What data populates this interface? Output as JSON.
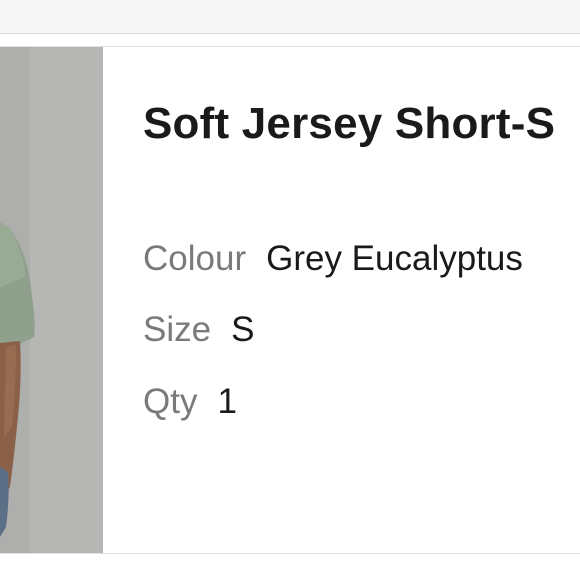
{
  "product": {
    "title": "Soft Jersey Short-S",
    "attributes": {
      "colour": {
        "label": "Colour",
        "value": "Grey Eucalyptus"
      },
      "size": {
        "label": "Size",
        "value": "S"
      },
      "qty": {
        "label": "Qty",
        "value": "1"
      }
    }
  },
  "colors": {
    "title_text": "#1a1a1a",
    "label_text": "#7a7a7a",
    "image_background": "#b4b4b2",
    "shirt_color": "#8da08b"
  }
}
